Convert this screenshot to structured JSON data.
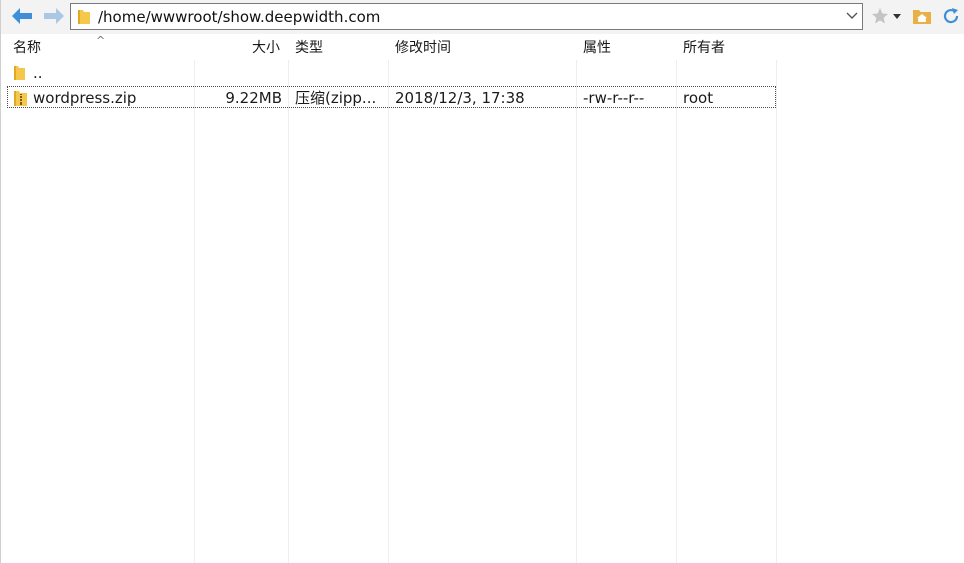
{
  "toolbar": {
    "address": "/home/wwwroot/show.deepwidth.com",
    "icons": [
      "back-arrow-icon",
      "forward-arrow-icon",
      "folder-icon",
      "chevron-down-icon",
      "star-icon",
      "home-folder-icon",
      "refresh-icon"
    ]
  },
  "columns": {
    "name": "名称",
    "size": "大小",
    "type": "类型",
    "modified": "修改时间",
    "attributes": "属性",
    "owner": "所有者",
    "sort_indicator": "^"
  },
  "rows": [
    {
      "name": "..",
      "size": "",
      "type": "",
      "modified": "",
      "attributes": "",
      "owner": ""
    },
    {
      "name": "wordpress.zip",
      "size": "9.22MB",
      "type": "压缩(zipp...",
      "modified": "2018/12/3, 17:38",
      "attributes": "-rw-r--r--",
      "owner": "root"
    }
  ],
  "colors": {
    "arrow_blue": "#3f8fd8",
    "folder_yellow": "#f5c84c",
    "star_gray": "#bdbdbd"
  }
}
